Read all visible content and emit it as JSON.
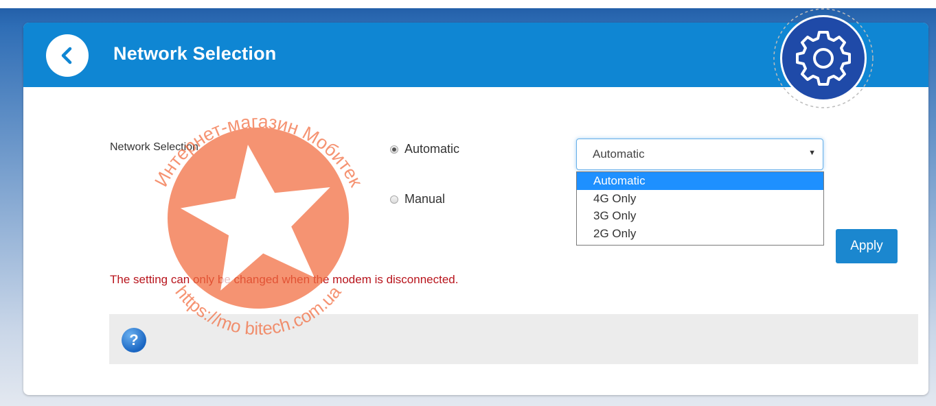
{
  "header": {
    "title": "Network Selection",
    "back_icon": "chevron-left-icon",
    "settings_icon": "gear-icon"
  },
  "form": {
    "label": "Network Selection",
    "radios": [
      {
        "label": "Automatic",
        "checked": true
      },
      {
        "label": "Manual",
        "checked": false
      }
    ],
    "select": {
      "value": "Automatic",
      "options": [
        "Automatic",
        "4G Only",
        "3G Only",
        "2G Only"
      ],
      "expanded": true
    },
    "apply_label": "Apply"
  },
  "warning_text": "The setting can only be changed when the modem is disconnected.",
  "help": {
    "icon_label": "?"
  },
  "watermark": {
    "arc_top": "Интернет-магазин Мобитек",
    "arc_bottom": "https://mo bitech.com.ua"
  },
  "colors": {
    "header_bg": "#0f86d3",
    "accent": "#1b87cf",
    "warning": "#b8141c",
    "watermark": "#f26a3d"
  }
}
